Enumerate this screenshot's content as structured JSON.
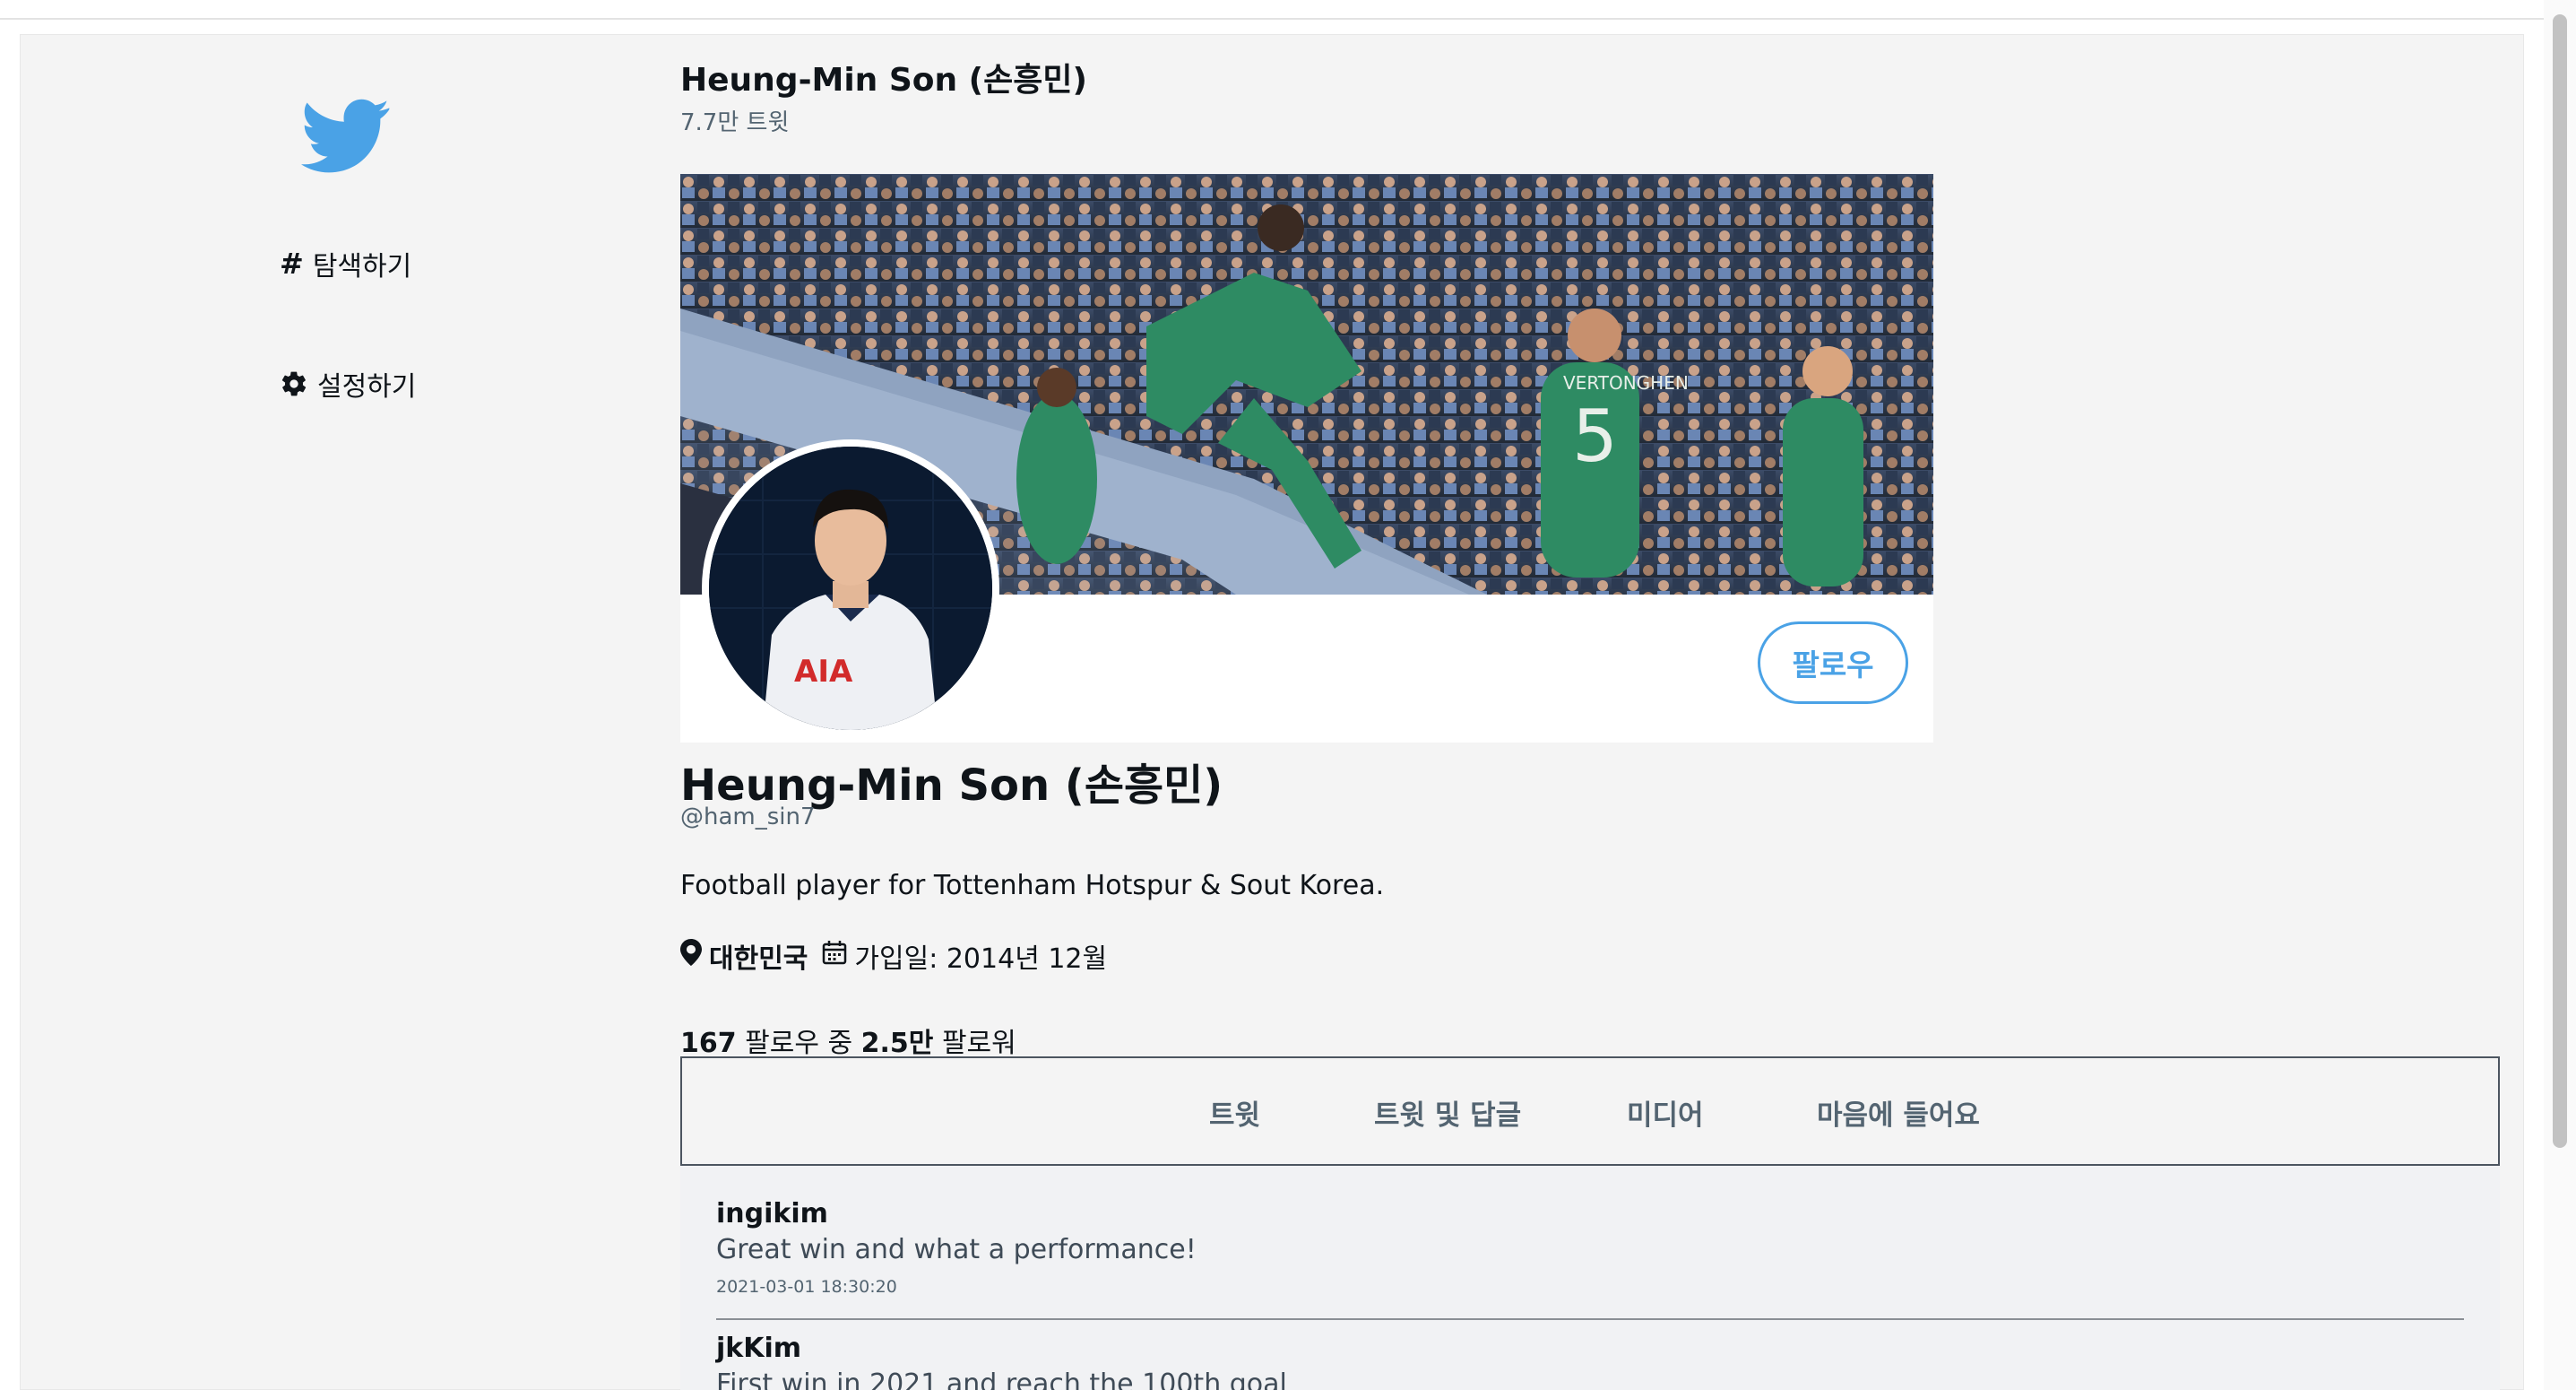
{
  "header": {
    "name": "Heung-Min Son (손흥민)",
    "tweet_count": "7.7만 트윗"
  },
  "sidebar": {
    "logo_icon": "twitter-bird-icon",
    "items": [
      {
        "label": "탐색하기",
        "icon": "hashtag-icon"
      },
      {
        "label": "설정하기",
        "icon": "gear-icon"
      }
    ]
  },
  "profile": {
    "name": "Heung-Min Son (손흥민)",
    "handle": "@ham_sin7",
    "bio": "Football player for Tottenham Hotspur & Sout Korea.",
    "location": "대한민국",
    "joined": "가입일: 2014년 12월",
    "following_count": "167",
    "following_label": "팔로우 중",
    "followers_count": "2.5만",
    "followers_label": "팔로워",
    "follow_button": "팔로우",
    "banner_jersey_number": "5",
    "banner_jersey_name": "VERTONGHEN",
    "avatar_shirt_text": "AIA"
  },
  "tabs": [
    "트윗",
    "트윗 및 답글",
    "미디어",
    "마음에 들어요"
  ],
  "tweets": [
    {
      "user": "ingikim",
      "text": "Great win and what a performance!",
      "date": "2021-03-01 18:30:20"
    },
    {
      "user": "jkKim",
      "text": "First win in 2021 and reach the 100th goal"
    }
  ],
  "colors": {
    "brand": "#4aa2e6",
    "background": "#f4f4f4",
    "tab_border": "#4c5560"
  }
}
